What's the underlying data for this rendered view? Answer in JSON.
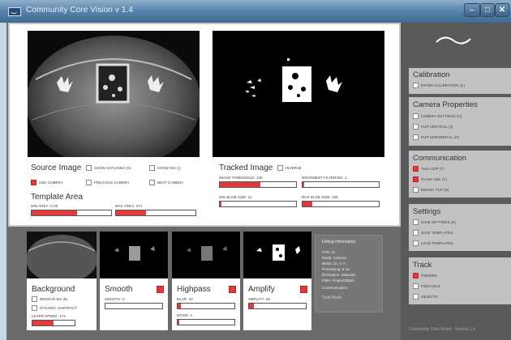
{
  "window": {
    "title": "Community Core Vision v 1.4",
    "min": "–",
    "max": "□",
    "close": "✕"
  },
  "source": {
    "title": "Source Image",
    "show_outlines": "SHOW OUTLINES (O)",
    "show_ids": "SHOW IDS (I)",
    "use_camera": "USE CAMERA",
    "previous_camera": "PREVIOUS CAMERA",
    "next_camera": "NEXT CAMERA",
    "use_camera_checked": true,
    "show_outlines_checked": false,
    "show_ids_checked": false
  },
  "template_area": {
    "title": "Template Area",
    "min_area_label": "MIN AREA: 0.00",
    "max_area_label": "MAX AREA: 374",
    "min_area_level": 0.57,
    "max_area_level": 0.38
  },
  "tracked": {
    "title": "Tracked Image",
    "inverse": "INVERSE",
    "image_threshold_label": "IMAGE THRESHOLD: 136",
    "movement_filtering_label": "MOVEMENT FILTERING: 1",
    "min_blob_label": "MIN BLOB SIZE: 11",
    "max_blob_label": "MAX BLOB SIZE: 136",
    "image_threshold_level": 0.53,
    "movement_filtering_level": 0.02,
    "min_blob_level": 0.02,
    "max_blob_level": 0.13
  },
  "filters": {
    "background": {
      "title": "Background",
      "remove_bg": "REMOVE BG (B)",
      "dynamic_subtract": "DYNAMIC SUBTRACT",
      "learn_speed_label": "LEARN SPEED: 173",
      "learn_speed_level": 0.5
    },
    "smooth": {
      "title": "Smooth",
      "smooth_label": "SMOOTH: 0",
      "enabled": true,
      "level": 0
    },
    "highpass": {
      "title": "Highpass",
      "blur_label": "BLUR: 10",
      "noise_label": "NOISE: 1",
      "enabled": true,
      "blur_level": 0.05,
      "noise_level": 0.03
    },
    "amplify": {
      "title": "Amplify",
      "amplify_label": "AMPLIFY: 36",
      "enabled": true,
      "level": 0.09
    }
  },
  "debug": {
    "title": "Debug Information",
    "lines": [
      "FPS: 21",
      "Mode: Camera",
      "Blobs: 10, 0, 0",
      "Processing: 6 ms",
      "Resolution: 320x240",
      "Filter: Finger/Object"
    ],
    "communication": "Communication",
    "dual_mode": "Dual Mode"
  },
  "sidebar": {
    "calibration": {
      "title": "Calibration",
      "enter": "ENTER CALIBRATION (C)"
    },
    "camera": {
      "title": "Camera Properties",
      "items": [
        "CAMERA SETTINGS (V)",
        "FLIP VERTICAL (J)",
        "FLIP HORIZONTAL (H)"
      ]
    },
    "communication": {
      "title": "Communication",
      "items": [
        "TUIO UDP (T)",
        "FLASH XML (F)",
        "BINARY TCP (N)"
      ],
      "checked": [
        true,
        true,
        false
      ]
    },
    "settings": {
      "title": "Settings",
      "items": [
        "SAVE SETTINGS (S)",
        "SAVE TEMPLATES",
        "LOAD TEMPLATES"
      ]
    },
    "track": {
      "title": "Track",
      "items": [
        "FINGERS",
        "FIDUCIALS",
        "OBJECTS"
      ],
      "checked": [
        true,
        false,
        false
      ]
    }
  },
  "footer": "Community Core Vision - Version 1.4",
  "colors": {
    "accent": "#e03a3a",
    "panel": "#c2c2c2",
    "frame": "#6f6f6f"
  }
}
